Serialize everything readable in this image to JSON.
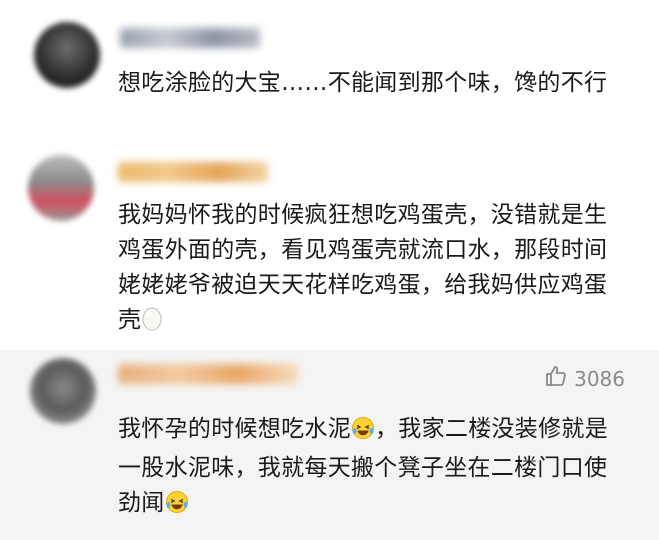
{
  "comments": [
    {
      "text": "想吃涂脸的大宝……不能闻到那个味，馋的不行"
    },
    {
      "text": "我妈妈怀我的时候疯狂想吃鸡蛋壳，没错就是生鸡蛋外面的壳，看见鸡蛋壳就流口水，那段时间姥姥姥爷被迫天天花样吃鸡蛋，给我妈供应鸡蛋壳",
      "emoji": "egg-icon"
    },
    {
      "text_part1": "我怀孕的时候想吃水泥",
      "text_part2": "，我家二楼没装修就是一股水泥味，我就每天搬个凳子坐在二楼门口使劲闻",
      "emoji": "laughing-crying-icon",
      "likes": "3086",
      "highlight_bg": "#f4f4f4"
    }
  ],
  "colors": {
    "text": "#1a1a1a",
    "muted": "#8a8a8a"
  }
}
